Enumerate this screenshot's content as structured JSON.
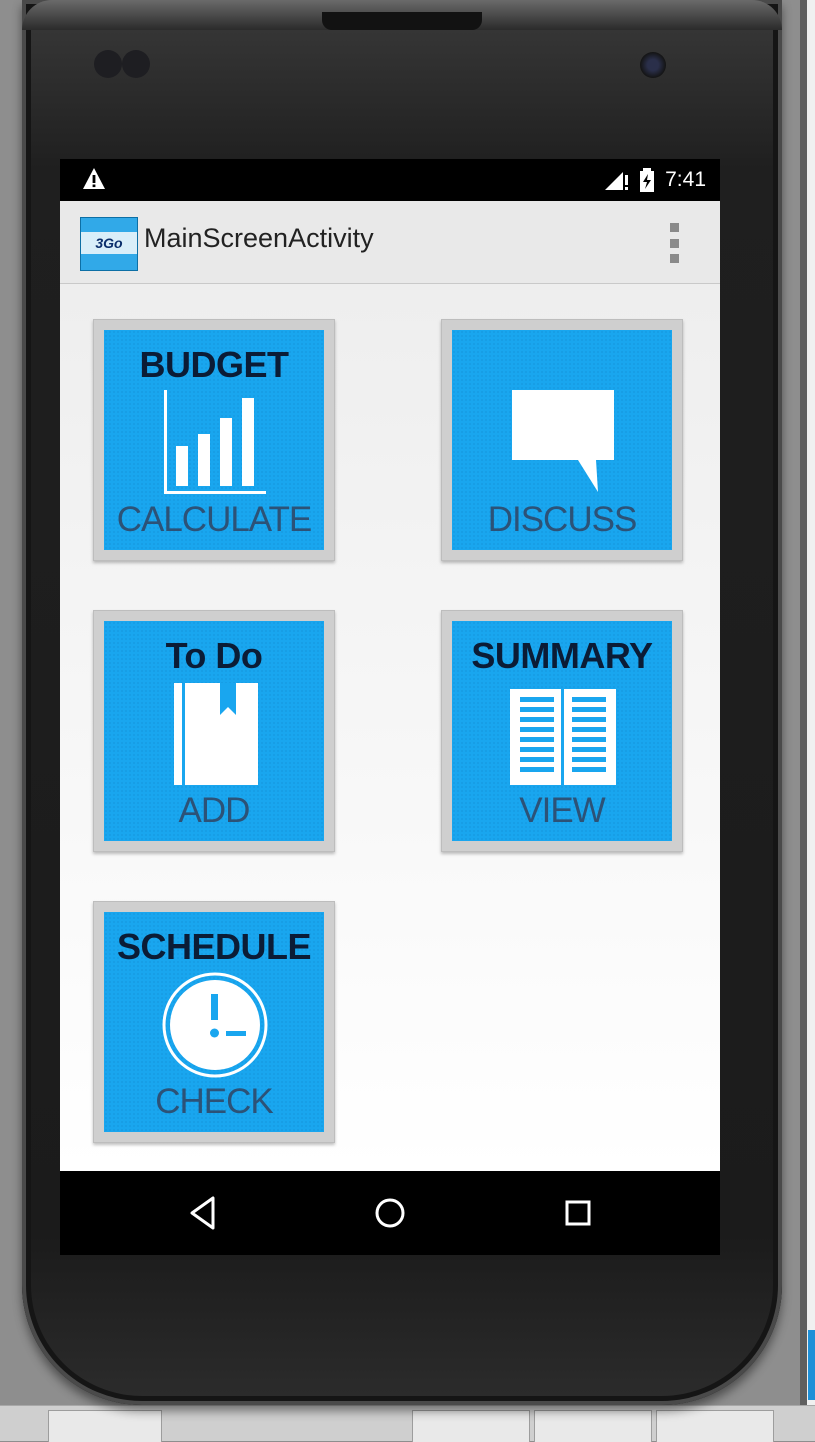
{
  "status_bar": {
    "time": "7:41",
    "icons": [
      "warning-icon",
      "signal-icon",
      "battery-icon"
    ]
  },
  "action_bar": {
    "logo_text": "3Go",
    "title": "MainScreenActivity",
    "menu_icon": "overflow-menu-icon"
  },
  "tiles": [
    {
      "id": "budget",
      "title": "BUDGET",
      "action": "CALCULATE",
      "icon": "bar-chart-icon"
    },
    {
      "id": "discuss",
      "title": "",
      "action": "DISCUSS",
      "icon": "speech-bubble-icon"
    },
    {
      "id": "todo",
      "title": "To Do",
      "action": "ADD",
      "icon": "bookmark-book-icon"
    },
    {
      "id": "summary",
      "title": "SUMMARY",
      "action": "VIEW",
      "icon": "open-book-icon"
    },
    {
      "id": "schedule",
      "title": "SCHEDULE",
      "action": "CHECK",
      "icon": "clock-icon"
    }
  ],
  "nav_bar": {
    "buttons": [
      "back-icon",
      "home-icon",
      "recents-icon"
    ]
  },
  "colors": {
    "tile_blue": "#19a6ef",
    "tile_frame": "#cfcfcf",
    "title_text": "#0b1c36",
    "action_text": "#2c5277",
    "action_bar": "#e9e9e9"
  }
}
